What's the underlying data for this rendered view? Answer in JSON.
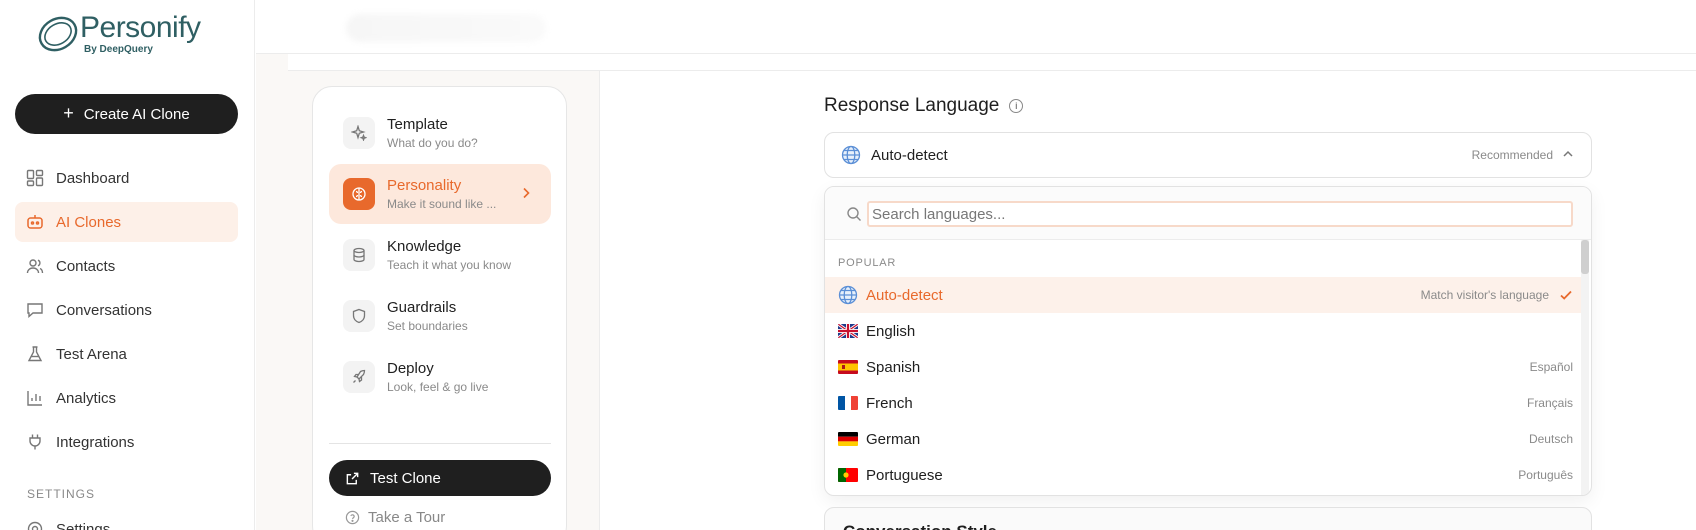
{
  "brand": {
    "name": "Personify",
    "sub": "By DeepQuery"
  },
  "sidebar": {
    "create_label": "Create AI Clone",
    "items": [
      {
        "label": "Dashboard"
      },
      {
        "label": "AI Clones"
      },
      {
        "label": "Contacts"
      },
      {
        "label": "Conversations"
      },
      {
        "label": "Test Arena"
      },
      {
        "label": "Analytics"
      },
      {
        "label": "Integrations"
      }
    ],
    "section_label": "SETTINGS",
    "settings_label": "Settings"
  },
  "steps": {
    "items": [
      {
        "title": "Template",
        "sub": "What do you do?"
      },
      {
        "title": "Personality",
        "sub": "Make it sound like ..."
      },
      {
        "title": "Knowledge",
        "sub": "Teach it what you know"
      },
      {
        "title": "Guardrails",
        "sub": "Set boundaries"
      },
      {
        "title": "Deploy",
        "sub": "Look, feel & go live"
      }
    ],
    "test_label": "Test Clone",
    "tour_label": "Take a Tour"
  },
  "response_language": {
    "title": "Response Language",
    "selected_value": "Auto-detect",
    "recommended": "Recommended",
    "search_placeholder": "Search languages...",
    "group_label": "POPULAR",
    "options": [
      {
        "name": "Auto-detect",
        "native": "Match visitor's language"
      },
      {
        "name": "English",
        "native": ""
      },
      {
        "name": "Spanish",
        "native": "Español"
      },
      {
        "name": "French",
        "native": "Français"
      },
      {
        "name": "German",
        "native": "Deutsch"
      },
      {
        "name": "Portuguese",
        "native": "Português"
      }
    ]
  },
  "next_section_title": "Conversation Style",
  "colors": {
    "accent": "#e8692c",
    "accent_bg": "#fde8dc",
    "dark": "#1f1f1f",
    "brand": "#2f5f63"
  }
}
